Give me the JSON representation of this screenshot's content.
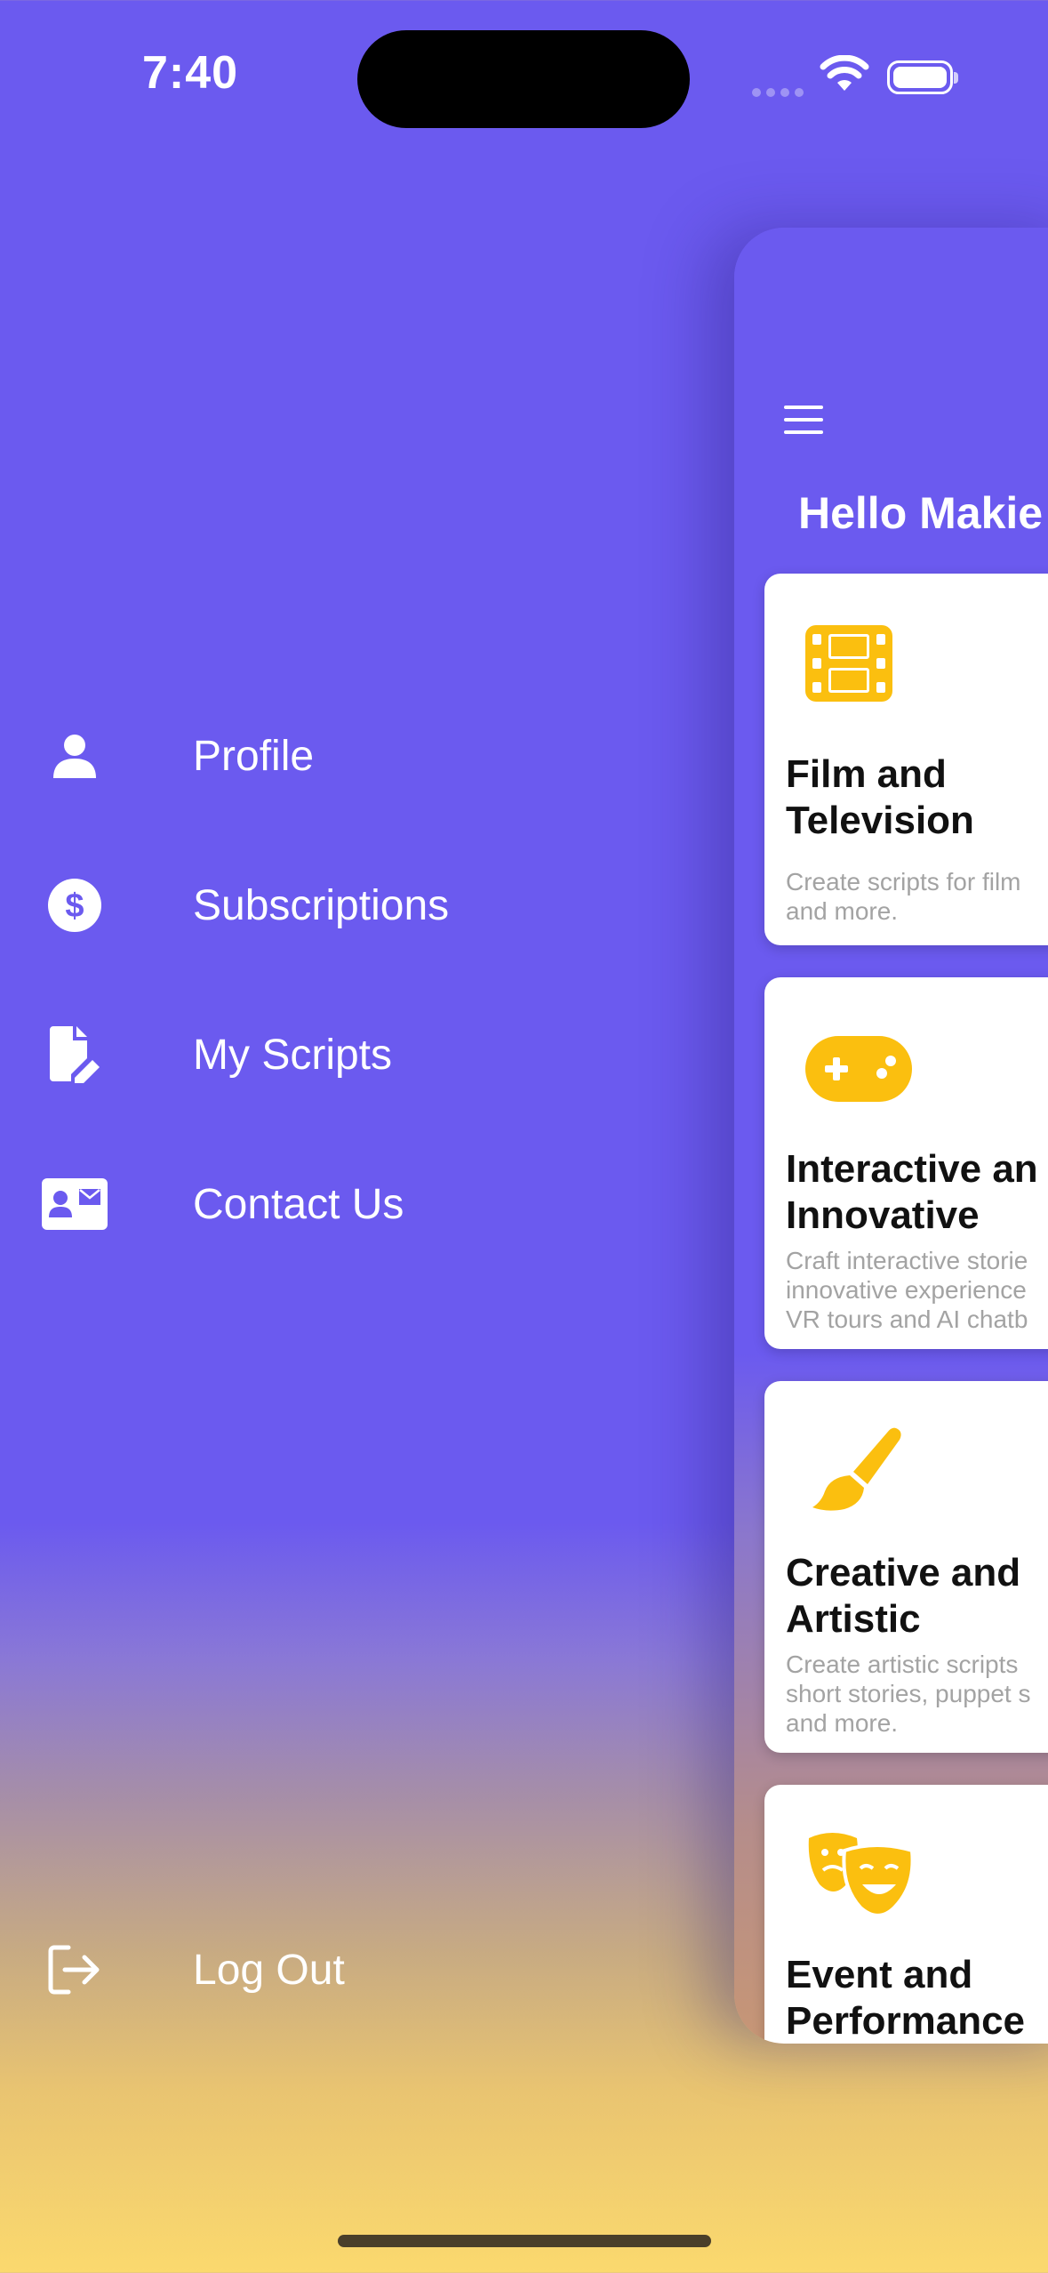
{
  "status_bar": {
    "time": "7:40"
  },
  "drawer": {
    "items": [
      {
        "label": "Profile",
        "icon": "person-icon"
      },
      {
        "label": "Subscriptions",
        "icon": "dollar-circle-icon"
      },
      {
        "label": "My Scripts",
        "icon": "document-edit-icon"
      },
      {
        "label": "Contact Us",
        "icon": "contact-card-icon"
      }
    ],
    "logout": {
      "label": "Log Out",
      "icon": "logout-icon"
    }
  },
  "main": {
    "greeting": "Hello Makie",
    "cards": [
      {
        "title_line1": "Film and",
        "title_line2": "Television",
        "desc_line1": "Create scripts for film",
        "desc_line2": "and more.",
        "desc_line3": "",
        "icon": "film-icon"
      },
      {
        "title_line1": "Interactive an",
        "title_line2": "Innovative",
        "desc_line1": "Craft interactive storie",
        "desc_line2": "innovative experience",
        "desc_line3": "VR tours and AI chatb",
        "icon": "gamepad-icon"
      },
      {
        "title_line1": "Creative and",
        "title_line2": "Artistic",
        "desc_line1": "Create artistic scripts",
        "desc_line2": "short stories, puppet s",
        "desc_line3": "and more.",
        "icon": "paintbrush-icon"
      },
      {
        "title_line1": "Event and",
        "title_line2": "Performance",
        "desc_line1": "",
        "desc_line2": "",
        "desc_line3": "",
        "icon": "theater-masks-icon"
      }
    ]
  },
  "colors": {
    "primary": "#6b5aef",
    "accent_yellow": "#fbbf0f",
    "bottom_gradient": "#fbd96e"
  }
}
